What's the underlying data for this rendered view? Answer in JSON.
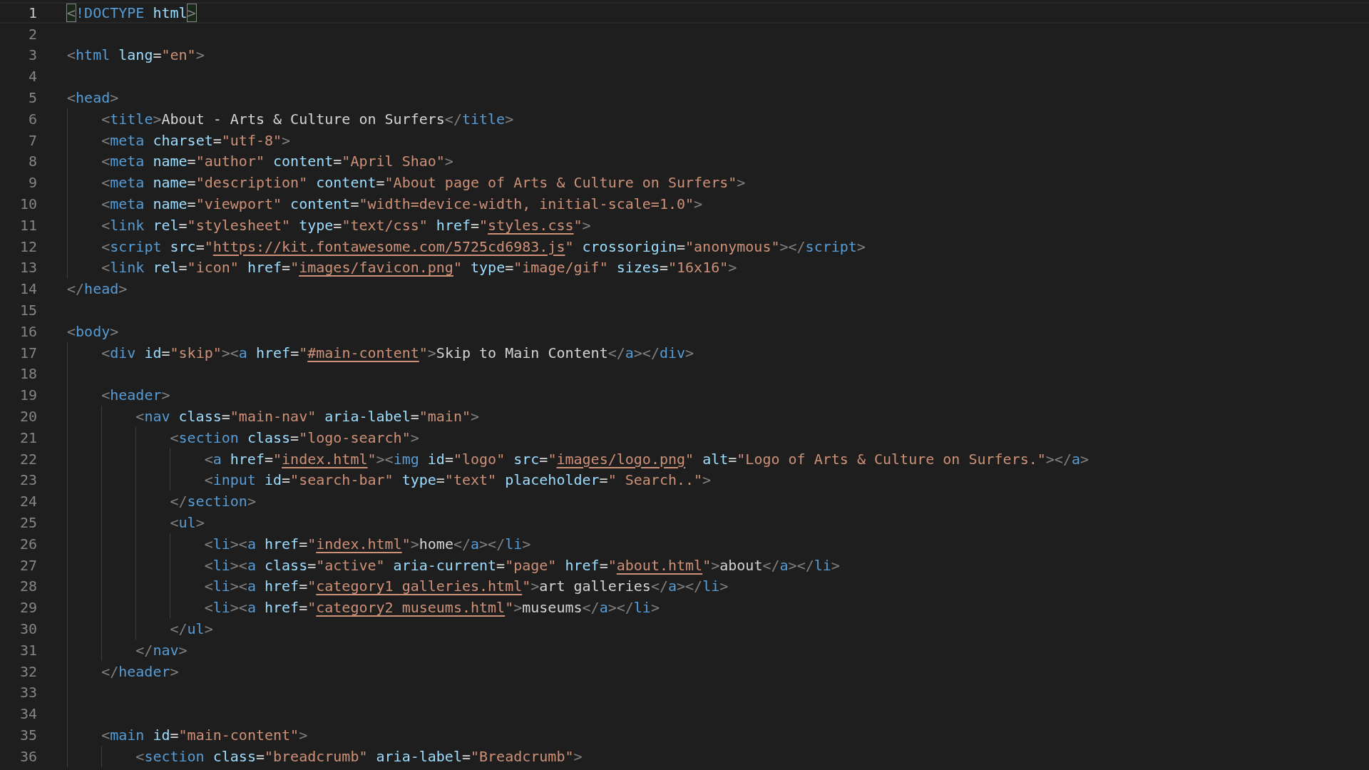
{
  "editor": {
    "lines": [
      {
        "number": "1",
        "current": true,
        "tokens": [
          {
            "kind": "bracket",
            "text": "<"
          },
          {
            "kind": "tag",
            "text": "!DOCTYPE"
          },
          {
            "kind": "attr",
            "text": " html"
          },
          {
            "kind": "bracket",
            "text": ">"
          }
        ]
      },
      {
        "number": "2",
        "current": false
      },
      {
        "number": "3",
        "current": false,
        "tokens": [
          {
            "kind": "p",
            "text": "<"
          },
          {
            "kind": "tag",
            "text": "html"
          },
          {
            "kind": "attr",
            "text": " lang"
          },
          {
            "kind": "t",
            "text": "="
          },
          {
            "kind": "s",
            "text": "\"en\""
          },
          {
            "kind": "p",
            "text": ">"
          }
        ]
      },
      {
        "number": "4",
        "current": false
      },
      {
        "number": "5",
        "current": false,
        "tokens": [
          {
            "kind": "p",
            "text": "<"
          },
          {
            "kind": "tag",
            "text": "head"
          },
          {
            "kind": "p",
            "text": ">"
          }
        ]
      },
      {
        "number": "6",
        "current": false,
        "tokens": [
          {
            "kind": "p",
            "text": "    <"
          },
          {
            "kind": "tag",
            "text": "title"
          },
          {
            "kind": "p",
            "text": ">"
          },
          {
            "kind": "t",
            "text": "About - Arts & Culture on Surfers"
          },
          {
            "kind": "p",
            "text": "</"
          },
          {
            "kind": "tag",
            "text": "title"
          },
          {
            "kind": "p",
            "text": ">"
          }
        ]
      },
      {
        "number": "7",
        "current": false,
        "tokens": [
          {
            "kind": "p",
            "text": "    <"
          },
          {
            "kind": "tag",
            "text": "meta"
          },
          {
            "kind": "attr",
            "text": " charset"
          },
          {
            "kind": "t",
            "text": "="
          },
          {
            "kind": "s",
            "text": "\"utf-8\""
          },
          {
            "kind": "p",
            "text": ">"
          }
        ]
      },
      {
        "number": "8",
        "current": false,
        "tokens": [
          {
            "kind": "p",
            "text": "    <"
          },
          {
            "kind": "tag",
            "text": "meta"
          },
          {
            "kind": "attr",
            "text": " name"
          },
          {
            "kind": "t",
            "text": "="
          },
          {
            "kind": "s",
            "text": "\"author\""
          },
          {
            "kind": "attr",
            "text": " content"
          },
          {
            "kind": "t",
            "text": "="
          },
          {
            "kind": "s",
            "text": "\"April Shao\""
          },
          {
            "kind": "p",
            "text": ">"
          }
        ]
      },
      {
        "number": "9",
        "current": false,
        "tokens": [
          {
            "kind": "p",
            "text": "    <"
          },
          {
            "kind": "tag",
            "text": "meta"
          },
          {
            "kind": "attr",
            "text": " name"
          },
          {
            "kind": "t",
            "text": "="
          },
          {
            "kind": "s",
            "text": "\"description\""
          },
          {
            "kind": "attr",
            "text": " content"
          },
          {
            "kind": "t",
            "text": "="
          },
          {
            "kind": "s",
            "text": "\"About page of Arts & Culture on Surfers\""
          },
          {
            "kind": "p",
            "text": ">"
          }
        ]
      },
      {
        "number": "10",
        "current": false,
        "tokens": [
          {
            "kind": "p",
            "text": "    <"
          },
          {
            "kind": "tag",
            "text": "meta"
          },
          {
            "kind": "attr",
            "text": " name"
          },
          {
            "kind": "t",
            "text": "="
          },
          {
            "kind": "s",
            "text": "\"viewport\""
          },
          {
            "kind": "attr",
            "text": " content"
          },
          {
            "kind": "t",
            "text": "="
          },
          {
            "kind": "s",
            "text": "\"width=device-width, initial-scale=1.0\""
          },
          {
            "kind": "p",
            "text": ">"
          }
        ]
      },
      {
        "number": "11",
        "current": false,
        "tokens": [
          {
            "kind": "p",
            "text": "    <"
          },
          {
            "kind": "tag",
            "text": "link"
          },
          {
            "kind": "attr",
            "text": " rel"
          },
          {
            "kind": "t",
            "text": "="
          },
          {
            "kind": "s",
            "text": "\"stylesheet\""
          },
          {
            "kind": "attr",
            "text": " type"
          },
          {
            "kind": "t",
            "text": "="
          },
          {
            "kind": "s",
            "text": "\"text/css\""
          },
          {
            "kind": "attr",
            "text": " href"
          },
          {
            "kind": "t",
            "text": "="
          },
          {
            "kind": "s",
            "text": "\""
          },
          {
            "kind": "u",
            "text": "styles.css"
          },
          {
            "kind": "s",
            "text": "\""
          },
          {
            "kind": "p",
            "text": ">"
          }
        ]
      },
      {
        "number": "12",
        "current": false,
        "tokens": [
          {
            "kind": "p",
            "text": "    <"
          },
          {
            "kind": "tag",
            "text": "script"
          },
          {
            "kind": "attr",
            "text": " src"
          },
          {
            "kind": "t",
            "text": "="
          },
          {
            "kind": "s",
            "text": "\""
          },
          {
            "kind": "u",
            "text": "https://kit.fontawesome.com/5725cd6983.js"
          },
          {
            "kind": "s",
            "text": "\""
          },
          {
            "kind": "attr",
            "text": " crossorigin"
          },
          {
            "kind": "t",
            "text": "="
          },
          {
            "kind": "s",
            "text": "\"anonymous\""
          },
          {
            "kind": "p",
            "text": "></"
          },
          {
            "kind": "tag",
            "text": "script"
          },
          {
            "kind": "p",
            "text": ">"
          }
        ]
      },
      {
        "number": "13",
        "current": false,
        "tokens": [
          {
            "kind": "p",
            "text": "    <"
          },
          {
            "kind": "tag",
            "text": "link"
          },
          {
            "kind": "attr",
            "text": " rel"
          },
          {
            "kind": "t",
            "text": "="
          },
          {
            "kind": "s",
            "text": "\"icon\""
          },
          {
            "kind": "attr",
            "text": " href"
          },
          {
            "kind": "t",
            "text": "="
          },
          {
            "kind": "s",
            "text": "\""
          },
          {
            "kind": "u",
            "text": "images/favicon.png"
          },
          {
            "kind": "s",
            "text": "\""
          },
          {
            "kind": "attr",
            "text": " type"
          },
          {
            "kind": "t",
            "text": "="
          },
          {
            "kind": "s",
            "text": "\"image/gif\""
          },
          {
            "kind": "attr",
            "text": " sizes"
          },
          {
            "kind": "t",
            "text": "="
          },
          {
            "kind": "s",
            "text": "\"16x16\""
          },
          {
            "kind": "p",
            "text": ">"
          }
        ]
      },
      {
        "number": "14",
        "current": false,
        "tokens": [
          {
            "kind": "p",
            "text": "</"
          },
          {
            "kind": "tag",
            "text": "head"
          },
          {
            "kind": "p",
            "text": ">"
          }
        ]
      },
      {
        "number": "15",
        "current": false
      },
      {
        "number": "16",
        "current": false,
        "tokens": [
          {
            "kind": "p",
            "text": "<"
          },
          {
            "kind": "tag",
            "text": "body"
          },
          {
            "kind": "p",
            "text": ">"
          }
        ]
      },
      {
        "number": "17",
        "current": false,
        "tokens": [
          {
            "kind": "p",
            "text": "    <"
          },
          {
            "kind": "tag",
            "text": "div"
          },
          {
            "kind": "attr",
            "text": " id"
          },
          {
            "kind": "t",
            "text": "="
          },
          {
            "kind": "s",
            "text": "\"skip\""
          },
          {
            "kind": "p",
            "text": "><"
          },
          {
            "kind": "tag",
            "text": "a"
          },
          {
            "kind": "attr",
            "text": " href"
          },
          {
            "kind": "t",
            "text": "="
          },
          {
            "kind": "s",
            "text": "\""
          },
          {
            "kind": "u",
            "text": "#main-content"
          },
          {
            "kind": "s",
            "text": "\""
          },
          {
            "kind": "p",
            "text": ">"
          },
          {
            "kind": "t",
            "text": "Skip to Main Content"
          },
          {
            "kind": "p",
            "text": "</"
          },
          {
            "kind": "tag",
            "text": "a"
          },
          {
            "kind": "p",
            "text": "></"
          },
          {
            "kind": "tag",
            "text": "div"
          },
          {
            "kind": "p",
            "text": ">"
          }
        ]
      },
      {
        "number": "18",
        "current": false
      },
      {
        "number": "19",
        "current": false,
        "tokens": [
          {
            "kind": "p",
            "text": "    <"
          },
          {
            "kind": "tag",
            "text": "header"
          },
          {
            "kind": "p",
            "text": ">"
          }
        ]
      },
      {
        "number": "20",
        "current": false,
        "tokens": [
          {
            "kind": "p",
            "text": "        <"
          },
          {
            "kind": "tag",
            "text": "nav"
          },
          {
            "kind": "attr",
            "text": " class"
          },
          {
            "kind": "t",
            "text": "="
          },
          {
            "kind": "s",
            "text": "\"main-nav\""
          },
          {
            "kind": "attr",
            "text": " aria-label"
          },
          {
            "kind": "t",
            "text": "="
          },
          {
            "kind": "s",
            "text": "\"main\""
          },
          {
            "kind": "p",
            "text": ">"
          }
        ]
      },
      {
        "number": "21",
        "current": false,
        "tokens": [
          {
            "kind": "p",
            "text": "            <"
          },
          {
            "kind": "tag",
            "text": "section"
          },
          {
            "kind": "attr",
            "text": " class"
          },
          {
            "kind": "t",
            "text": "="
          },
          {
            "kind": "s",
            "text": "\"logo-search\""
          },
          {
            "kind": "p",
            "text": ">"
          }
        ]
      },
      {
        "number": "22",
        "current": false,
        "tokens": [
          {
            "kind": "p",
            "text": "                <"
          },
          {
            "kind": "tag",
            "text": "a"
          },
          {
            "kind": "attr",
            "text": " href"
          },
          {
            "kind": "t",
            "text": "="
          },
          {
            "kind": "s",
            "text": "\""
          },
          {
            "kind": "u",
            "text": "index.html"
          },
          {
            "kind": "s",
            "text": "\""
          },
          {
            "kind": "p",
            "text": "><"
          },
          {
            "kind": "tag",
            "text": "img"
          },
          {
            "kind": "attr",
            "text": " id"
          },
          {
            "kind": "t",
            "text": "="
          },
          {
            "kind": "s",
            "text": "\"logo\""
          },
          {
            "kind": "attr",
            "text": " src"
          },
          {
            "kind": "t",
            "text": "="
          },
          {
            "kind": "s",
            "text": "\""
          },
          {
            "kind": "u",
            "text": "images/logo.png"
          },
          {
            "kind": "s",
            "text": "\""
          },
          {
            "kind": "attr",
            "text": " alt"
          },
          {
            "kind": "t",
            "text": "="
          },
          {
            "kind": "s",
            "text": "\"Logo of Arts & Culture on Surfers.\""
          },
          {
            "kind": "p",
            "text": "></"
          },
          {
            "kind": "tag",
            "text": "a"
          },
          {
            "kind": "p",
            "text": ">"
          }
        ]
      },
      {
        "number": "23",
        "current": false,
        "tokens": [
          {
            "kind": "p",
            "text": "                <"
          },
          {
            "kind": "tag",
            "text": "input"
          },
          {
            "kind": "attr",
            "text": " id"
          },
          {
            "kind": "t",
            "text": "="
          },
          {
            "kind": "s",
            "text": "\"search-bar\""
          },
          {
            "kind": "attr",
            "text": " type"
          },
          {
            "kind": "t",
            "text": "="
          },
          {
            "kind": "s",
            "text": "\"text\""
          },
          {
            "kind": "attr",
            "text": " placeholder"
          },
          {
            "kind": "t",
            "text": "="
          },
          {
            "kind": "s",
            "text": "\" Search..\""
          },
          {
            "kind": "p",
            "text": ">"
          }
        ]
      },
      {
        "number": "24",
        "current": false,
        "tokens": [
          {
            "kind": "p",
            "text": "            </"
          },
          {
            "kind": "tag",
            "text": "section"
          },
          {
            "kind": "p",
            "text": ">"
          }
        ]
      },
      {
        "number": "25",
        "current": false,
        "tokens": [
          {
            "kind": "p",
            "text": "            <"
          },
          {
            "kind": "tag",
            "text": "ul"
          },
          {
            "kind": "p",
            "text": ">"
          }
        ]
      },
      {
        "number": "26",
        "current": false,
        "tokens": [
          {
            "kind": "p",
            "text": "                <"
          },
          {
            "kind": "tag",
            "text": "li"
          },
          {
            "kind": "p",
            "text": "><"
          },
          {
            "kind": "tag",
            "text": "a"
          },
          {
            "kind": "attr",
            "text": " href"
          },
          {
            "kind": "t",
            "text": "="
          },
          {
            "kind": "s",
            "text": "\""
          },
          {
            "kind": "u",
            "text": "index.html"
          },
          {
            "kind": "s",
            "text": "\""
          },
          {
            "kind": "p",
            "text": ">"
          },
          {
            "kind": "t",
            "text": "home"
          },
          {
            "kind": "p",
            "text": "</"
          },
          {
            "kind": "tag",
            "text": "a"
          },
          {
            "kind": "p",
            "text": "></"
          },
          {
            "kind": "tag",
            "text": "li"
          },
          {
            "kind": "p",
            "text": ">"
          }
        ]
      },
      {
        "number": "27",
        "current": false,
        "tokens": [
          {
            "kind": "p",
            "text": "                <"
          },
          {
            "kind": "tag",
            "text": "li"
          },
          {
            "kind": "p",
            "text": "><"
          },
          {
            "kind": "tag",
            "text": "a"
          },
          {
            "kind": "attr",
            "text": " class"
          },
          {
            "kind": "t",
            "text": "="
          },
          {
            "kind": "s",
            "text": "\"active\""
          },
          {
            "kind": "attr",
            "text": " aria-current"
          },
          {
            "kind": "t",
            "text": "="
          },
          {
            "kind": "s",
            "text": "\"page\""
          },
          {
            "kind": "attr",
            "text": " href"
          },
          {
            "kind": "t",
            "text": "="
          },
          {
            "kind": "s",
            "text": "\""
          },
          {
            "kind": "u",
            "text": "about.html"
          },
          {
            "kind": "s",
            "text": "\""
          },
          {
            "kind": "p",
            "text": ">"
          },
          {
            "kind": "t",
            "text": "about"
          },
          {
            "kind": "p",
            "text": "</"
          },
          {
            "kind": "tag",
            "text": "a"
          },
          {
            "kind": "p",
            "text": "></"
          },
          {
            "kind": "tag",
            "text": "li"
          },
          {
            "kind": "p",
            "text": ">"
          }
        ]
      },
      {
        "number": "28",
        "current": false,
        "tokens": [
          {
            "kind": "p",
            "text": "                <"
          },
          {
            "kind": "tag",
            "text": "li"
          },
          {
            "kind": "p",
            "text": "><"
          },
          {
            "kind": "tag",
            "text": "a"
          },
          {
            "kind": "attr",
            "text": " href"
          },
          {
            "kind": "t",
            "text": "="
          },
          {
            "kind": "s",
            "text": "\""
          },
          {
            "kind": "u",
            "text": "category1_galleries.html"
          },
          {
            "kind": "s",
            "text": "\""
          },
          {
            "kind": "p",
            "text": ">"
          },
          {
            "kind": "t",
            "text": "art galleries"
          },
          {
            "kind": "p",
            "text": "</"
          },
          {
            "kind": "tag",
            "text": "a"
          },
          {
            "kind": "p",
            "text": "></"
          },
          {
            "kind": "tag",
            "text": "li"
          },
          {
            "kind": "p",
            "text": ">"
          }
        ]
      },
      {
        "number": "29",
        "current": false,
        "tokens": [
          {
            "kind": "p",
            "text": "                <"
          },
          {
            "kind": "tag",
            "text": "li"
          },
          {
            "kind": "p",
            "text": "><"
          },
          {
            "kind": "tag",
            "text": "a"
          },
          {
            "kind": "attr",
            "text": " href"
          },
          {
            "kind": "t",
            "text": "="
          },
          {
            "kind": "s",
            "text": "\""
          },
          {
            "kind": "u",
            "text": "category2_museums.html"
          },
          {
            "kind": "s",
            "text": "\""
          },
          {
            "kind": "p",
            "text": ">"
          },
          {
            "kind": "t",
            "text": "museums"
          },
          {
            "kind": "p",
            "text": "</"
          },
          {
            "kind": "tag",
            "text": "a"
          },
          {
            "kind": "p",
            "text": "></"
          },
          {
            "kind": "tag",
            "text": "li"
          },
          {
            "kind": "p",
            "text": ">"
          }
        ]
      },
      {
        "number": "30",
        "current": false,
        "tokens": [
          {
            "kind": "p",
            "text": "            </"
          },
          {
            "kind": "tag",
            "text": "ul"
          },
          {
            "kind": "p",
            "text": ">"
          }
        ]
      },
      {
        "number": "31",
        "current": false,
        "tokens": [
          {
            "kind": "p",
            "text": "        </"
          },
          {
            "kind": "tag",
            "text": "nav"
          },
          {
            "kind": "p",
            "text": ">"
          }
        ]
      },
      {
        "number": "32",
        "current": false,
        "tokens": [
          {
            "kind": "p",
            "text": "    </"
          },
          {
            "kind": "tag",
            "text": "header"
          },
          {
            "kind": "p",
            "text": ">"
          }
        ]
      },
      {
        "number": "33",
        "current": false
      },
      {
        "number": "34",
        "current": false
      },
      {
        "number": "35",
        "current": false,
        "tokens": [
          {
            "kind": "p",
            "text": "    <"
          },
          {
            "kind": "tag",
            "text": "main"
          },
          {
            "kind": "attr",
            "text": " id"
          },
          {
            "kind": "t",
            "text": "="
          },
          {
            "kind": "s",
            "text": "\"main-content\""
          },
          {
            "kind": "p",
            "text": ">"
          }
        ]
      },
      {
        "number": "36",
        "current": false,
        "tokens": [
          {
            "kind": "p",
            "text": "        <"
          },
          {
            "kind": "tag",
            "text": "section"
          },
          {
            "kind": "attr",
            "text": " class"
          },
          {
            "kind": "t",
            "text": "="
          },
          {
            "kind": "s",
            "text": "\"breadcrumb\""
          },
          {
            "kind": "attr",
            "text": " aria-label"
          },
          {
            "kind": "t",
            "text": "="
          },
          {
            "kind": "s",
            "text": "\"Breadcrumb\""
          },
          {
            "kind": "p",
            "text": ">"
          }
        ]
      }
    ]
  }
}
